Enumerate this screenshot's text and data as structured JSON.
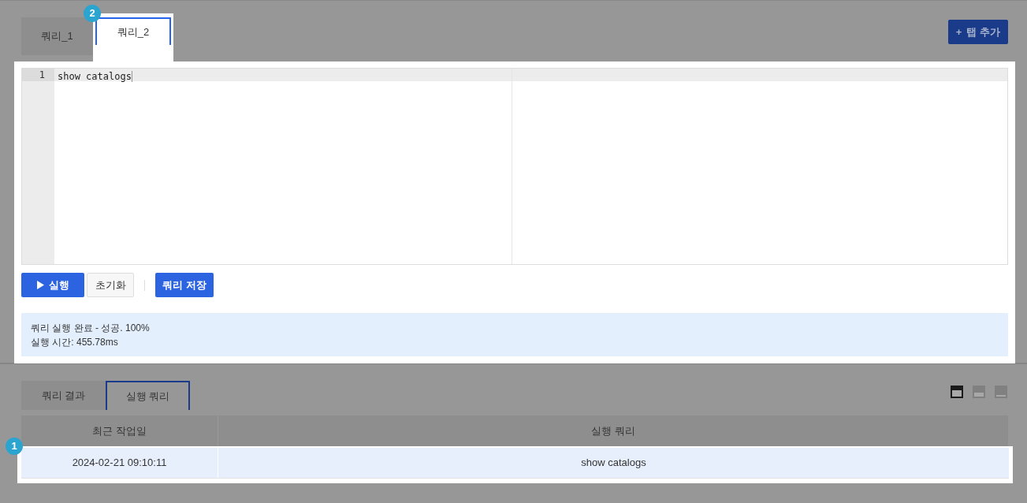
{
  "query_tabs": [
    {
      "label": "쿼리_1",
      "selected": false
    },
    {
      "label": "쿼리_2",
      "selected": true
    }
  ],
  "add_tab_button": {
    "icon": "+",
    "label": "탭 추가"
  },
  "editor": {
    "lines": [
      {
        "number": "1",
        "text": "show catalogs"
      }
    ]
  },
  "buttons": [
    {
      "kind": "run",
      "label": "실행"
    },
    {
      "kind": "reset",
      "label": "초기화"
    },
    {
      "kind": "save",
      "label": "쿼리 저장"
    }
  ],
  "status": {
    "lines": [
      "쿼리 실행 완료 - 성공. 100%",
      "실행 시간: 455.78ms"
    ]
  },
  "result_tabs": [
    {
      "label": "쿼리 결과",
      "selected": false
    },
    {
      "label": "실행 쿼리",
      "selected": true
    }
  ],
  "layout_toggles": [
    {
      "kind": "large",
      "selected": true
    },
    {
      "kind": "medium",
      "selected": false
    },
    {
      "kind": "small",
      "selected": false
    }
  ],
  "table": {
    "columns": [
      "최근 작업일",
      "실행 쿼리"
    ],
    "rows": [
      [
        "2024-02-21 09:10:11",
        "show catalogs"
      ]
    ]
  },
  "callouts": [
    "2",
    "1"
  ]
}
